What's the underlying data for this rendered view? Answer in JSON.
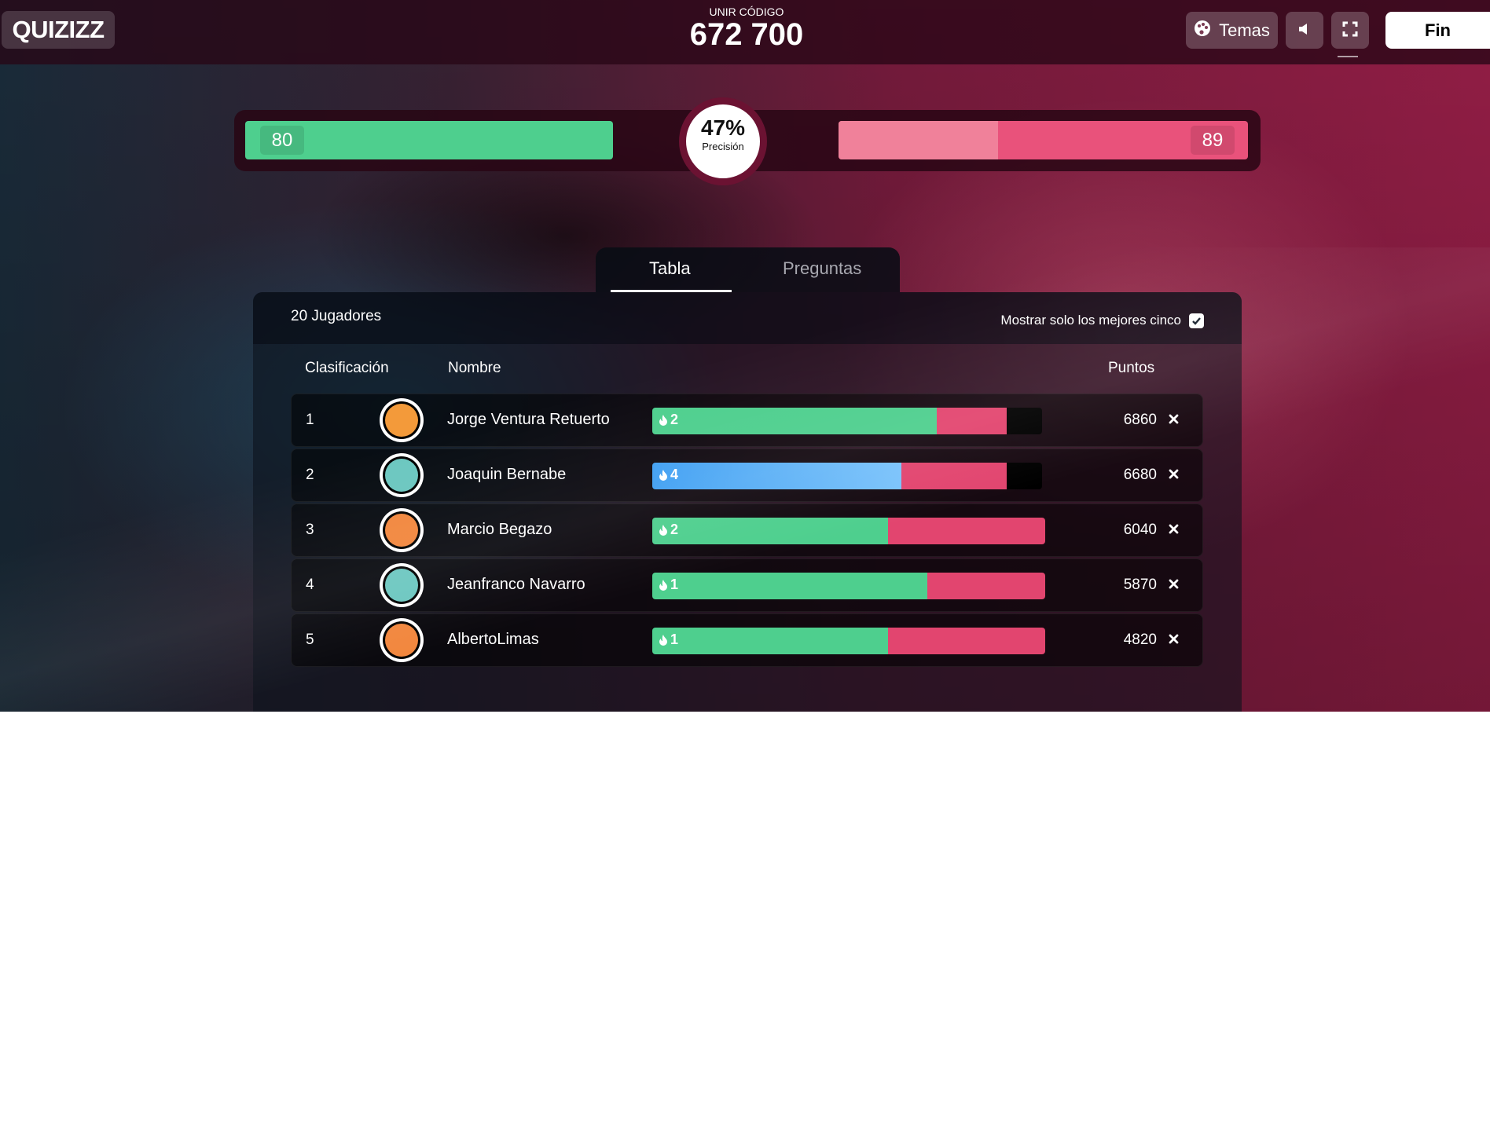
{
  "app": {
    "logo": "QUIZIZZ"
  },
  "header": {
    "join_label": "UNIR CÓDIGO",
    "join_code": "672 700",
    "themes_label": "Temas",
    "end_label": "Fin"
  },
  "accuracy": {
    "correct": "80",
    "incorrect": "89",
    "percent": "47%",
    "label": "Precisión",
    "correct_color": "#4ecf8e",
    "incorrect_color": "#e9527b"
  },
  "tabs": {
    "table": "Tabla",
    "questions": "Preguntas",
    "active": "Tabla"
  },
  "panel": {
    "players_count": "20 Jugadores",
    "top_five_label": "Mostrar solo los mejores cinco",
    "top_five_checked": true
  },
  "columns": {
    "rank": "Clasificación",
    "name": "Nombre",
    "points": "Puntos"
  },
  "players": [
    {
      "rank": "1",
      "name": "Jorge Ventura Retuerto",
      "streak": "2",
      "points": "6860",
      "correct_fraction": 0.73,
      "incorrect_fraction": 0.18,
      "streak_color": "#4ecf8e",
      "avatar_color": "#f39a3a"
    },
    {
      "rank": "2",
      "name": "Joaquin Bernabe",
      "streak": "4",
      "points": "6680",
      "correct_fraction": 0.64,
      "incorrect_fraction": 0.27,
      "streak_color": "#4aa7f5",
      "avatar_color": "#6cc7c0"
    },
    {
      "rank": "3",
      "name": "Marcio Begazo",
      "streak": "2",
      "points": "6040",
      "correct_fraction": 0.6,
      "incorrect_fraction": 0.4,
      "streak_color": "#4ecf8e",
      "avatar_color": "#f2873e"
    },
    {
      "rank": "4",
      "name": "Jeanfranco Navarro",
      "streak": "1",
      "points": "5870",
      "correct_fraction": 0.7,
      "incorrect_fraction": 0.3,
      "streak_color": "#4ecf8e",
      "avatar_color": "#6cc7c0"
    },
    {
      "rank": "5",
      "name": "AlbertoLimas",
      "streak": "1",
      "points": "4820",
      "correct_fraction": 0.6,
      "incorrect_fraction": 0.4,
      "streak_color": "#4ecf8e",
      "avatar_color": "#f2873e"
    }
  ],
  "icons": {
    "themes": "palette-icon",
    "sound": "speaker-icon",
    "fullscreen": "fullscreen-icon",
    "remove": "close-icon",
    "streak": "flame-icon",
    "checkbox": "check-icon"
  }
}
